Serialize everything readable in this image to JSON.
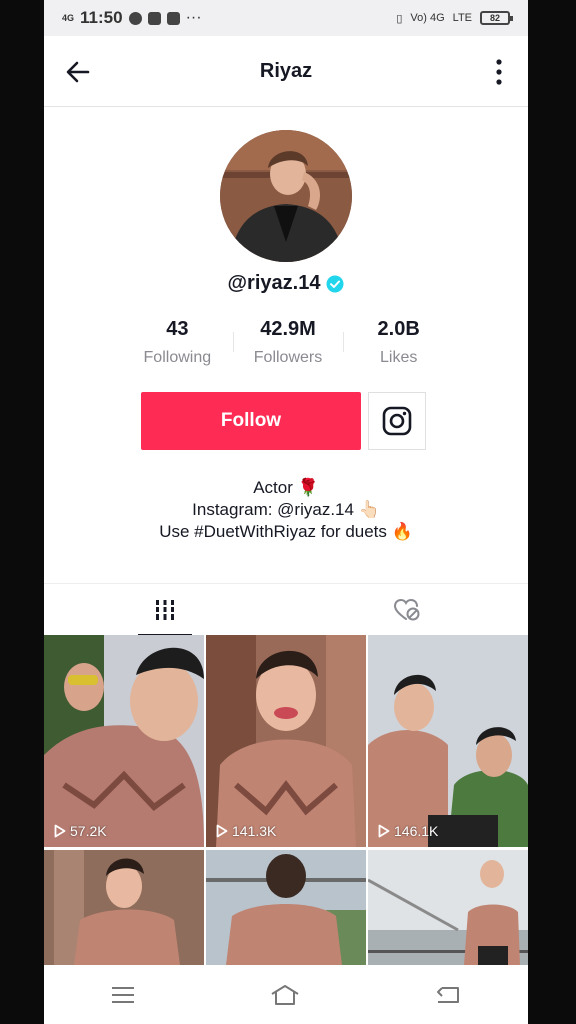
{
  "status_bar": {
    "network": "4G",
    "time": "11:50",
    "more": "···",
    "carrier": "Vo) 4G",
    "lte": "LTE",
    "battery": "82"
  },
  "header": {
    "title": "Riyaz"
  },
  "profile": {
    "username": "@riyaz.14",
    "verified": true,
    "stats": [
      {
        "value": "43",
        "label": "Following"
      },
      {
        "value": "42.9M",
        "label": "Followers"
      },
      {
        "value": "2.0B",
        "label": "Likes"
      }
    ],
    "follow_label": "Follow",
    "bio": [
      "Actor 🌹",
      "Instagram: @riyaz.14 👆🏻",
      "Use #DuetWithRiyaz for duets 🔥"
    ]
  },
  "tabs": [
    {
      "icon": "grid-icon",
      "active": true
    },
    {
      "icon": "liked-hidden-icon",
      "active": false
    }
  ],
  "videos": [
    {
      "views": "57.2K"
    },
    {
      "views": "141.3K"
    },
    {
      "views": "146.1K"
    },
    {
      "views": ""
    },
    {
      "views": ""
    },
    {
      "views": ""
    }
  ],
  "colors": {
    "accent": "#fe2c55",
    "verified": "#20d5ec",
    "text": "#161823",
    "muted": "#8a8b91"
  },
  "nav_bar": [
    "menu-icon",
    "home-icon",
    "back-icon"
  ]
}
